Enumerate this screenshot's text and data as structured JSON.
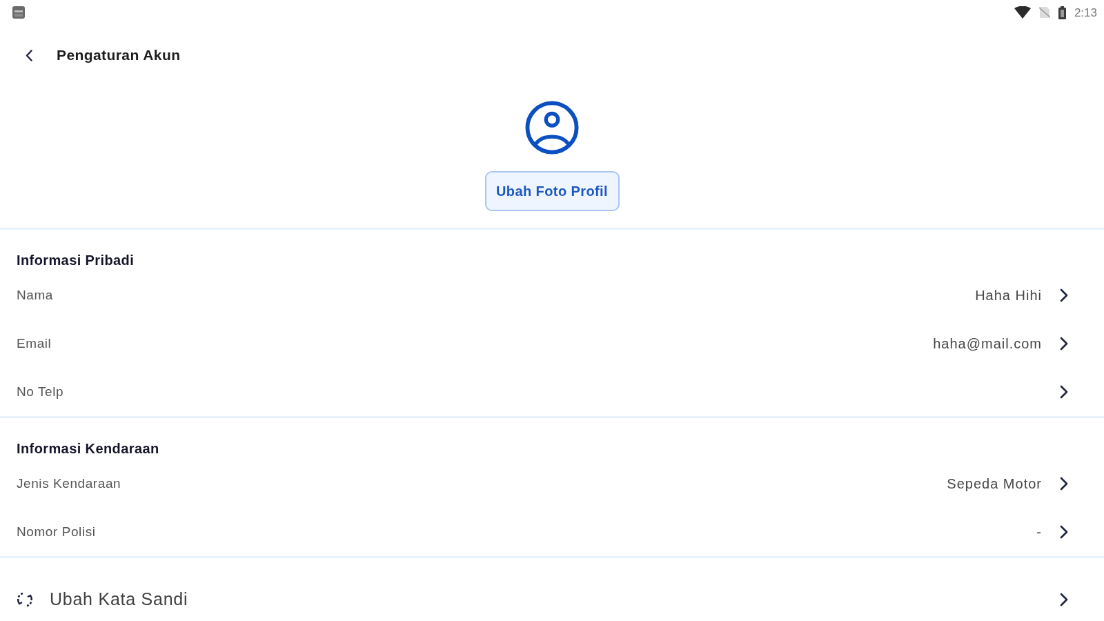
{
  "status_bar": {
    "time": "2:13"
  },
  "header": {
    "title": "Pengaturan Akun"
  },
  "profile": {
    "button": "Ubah Foto Profil"
  },
  "sections": [
    {
      "title": "Informasi Pribadi",
      "rows": [
        {
          "label": "Nama",
          "value": "Haha Hihi"
        },
        {
          "label": "Email",
          "value": "haha@mail.com"
        },
        {
          "label": "No Telp"
        }
      ]
    },
    {
      "title": "Informasi Kendaraan",
      "rows": [
        {
          "label": "Jenis Kendaraan",
          "value": "Sepeda Motor"
        },
        {
          "label": "Nomor Polisi",
          "value": "-"
        }
      ]
    }
  ],
  "actions": [
    {
      "label": "Ubah Kata Sandi"
    }
  ]
}
